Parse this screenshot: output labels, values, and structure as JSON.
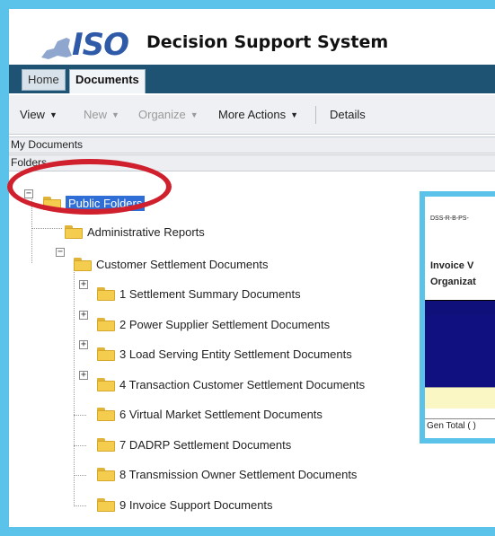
{
  "header": {
    "logo_text": "ISO",
    "app_title": "Decision Support System"
  },
  "tabs": [
    {
      "label": "Home"
    },
    {
      "label": "Documents"
    }
  ],
  "toolbar": {
    "view": "View",
    "new": "New",
    "organize": "Organize",
    "more_actions": "More Actions",
    "details": "Details"
  },
  "sections": {
    "my_documents": "My Documents",
    "folders": "Folders"
  },
  "tree": {
    "root": "Public Folders",
    "admin_reports": "Administrative Reports",
    "customer_settlement": "Customer Settlement Documents",
    "children": [
      "1 Settlement Summary Documents",
      "2 Power Supplier Settlement Documents",
      "3 Load Serving Entity Settlement Documents",
      "4 Transaction Customer Settlement Documents",
      "6 Virtual Market Settlement Documents",
      "7 DADRP Settlement Documents",
      "8 Transmission Owner Settlement Documents",
      "9 Invoice Support Documents"
    ]
  },
  "overlay": {
    "code": "DSS-R-B-PS-",
    "heading1": "Invoice V",
    "heading2": "Organizat",
    "total": "Gen Total ( )"
  },
  "colors": {
    "frame": "#5bc3ea",
    "tabbar": "#1f5373",
    "selection": "#2e6ed6",
    "annotation": "#d0202e"
  }
}
